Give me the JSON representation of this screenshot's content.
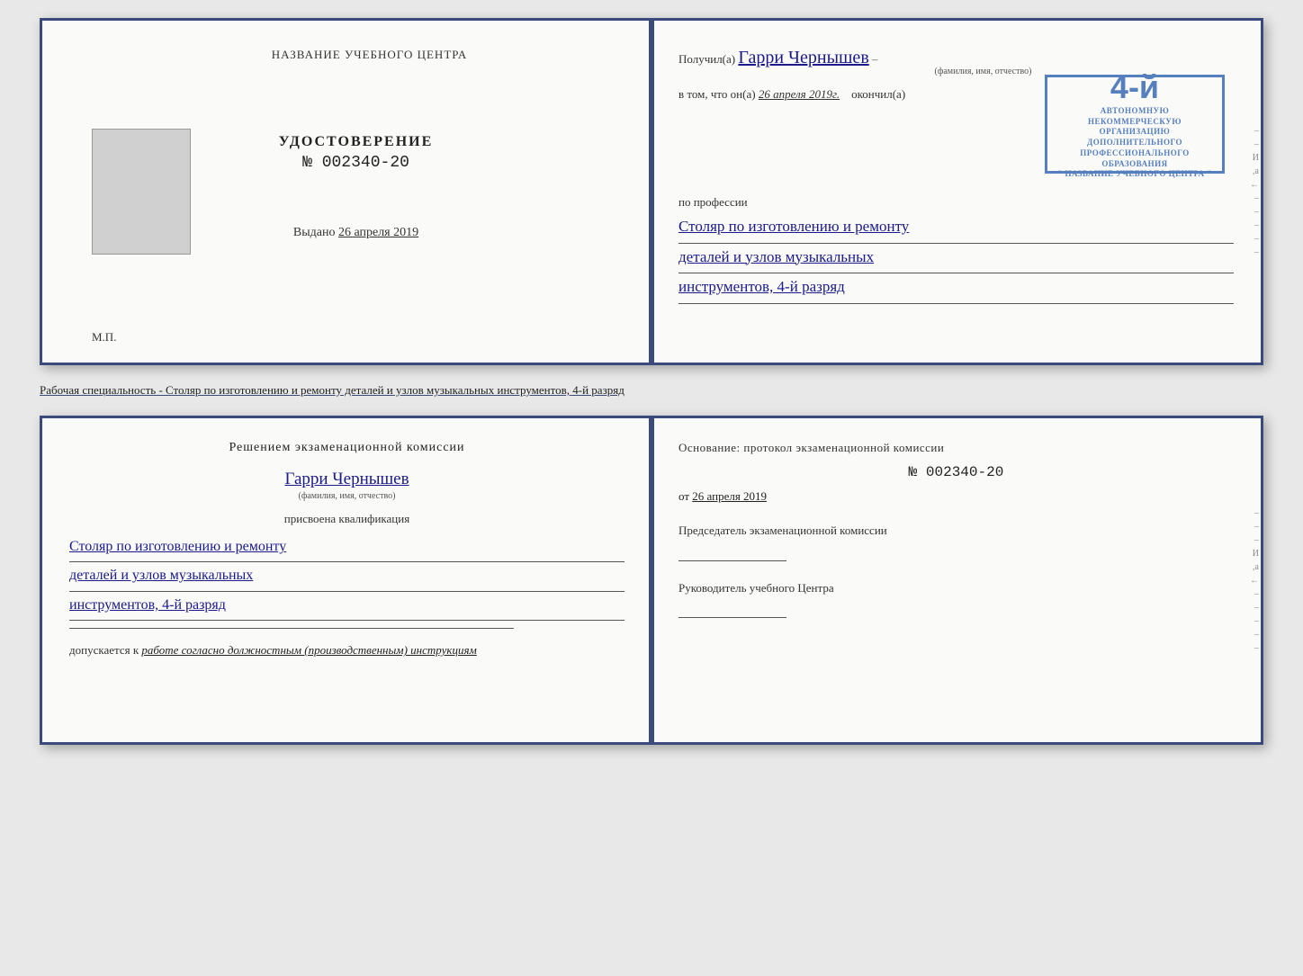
{
  "top_spread": {
    "left_page": {
      "title": "НАЗВАНИЕ УЧЕБНОГО ЦЕНТРА",
      "udostoverenie_label": "УДОСТОВЕРЕНИЕ",
      "number_prefix": "№",
      "number": "002340-20",
      "vydano_label": "Выдано",
      "vydano_date": "26 апреля 2019",
      "mp_label": "М.П."
    },
    "right_page": {
      "poluchil_label": "Получил(а)",
      "poluchil_name": "Гарри Чернышев",
      "poluchil_subtitle": "(фамилия, имя, отчество)",
      "vtom_label": "в том, что он(а)",
      "vtom_date": "26 апреля 2019г.",
      "okonchil_label": "окончил(а)",
      "stamp_number": "4-й",
      "stamp_line1": "АВТОНОМНУЮ НЕКОММЕРЧЕСКУЮ ОРГАНИЗАЦИЮ",
      "stamp_line2": "ДОПОЛНИТЕЛЬНОГО ПРОФЕССИОНАЛЬНОГО ОБРАЗОВАНИЯ",
      "stamp_line3": "\" НАЗВАНИЕ УЧЕБНОГО ЦЕНТРА \"",
      "po_professii_label": "по профессии",
      "profession_line1": "Столяр по изготовлению и ремонту",
      "profession_line2": "деталей и узлов музыкальных",
      "profession_line3": "инструментов, 4-й разряд"
    }
  },
  "specialist_text": "Рабочая специальность - Столяр по изготовлению и ремонту деталей и узлов музыкальных инструментов, 4-й разряд",
  "bottom_spread": {
    "left_page": {
      "resheniem_title": "Решением  экзаменационной  комиссии",
      "name": "Гарри Чернышев",
      "fio_subtitle": "(фамилия, имя, отчество)",
      "prisvoyena_label": "присвоена квалификация",
      "profession_line1": "Столяр по изготовлению и ремонту",
      "profession_line2": "деталей и узлов музыкальных",
      "profession_line3": "инструментов, 4-й разряд",
      "dopusk_label": "допускается к",
      "dopusk_value": "работе согласно должностным (производственным) инструкциям"
    },
    "right_page": {
      "osnovanie_label": "Основание:  протокол  экзаменационной  комиссии",
      "number_prefix": "№",
      "number": "002340-20",
      "ot_prefix": "от",
      "ot_date": "26 апреля 2019",
      "predsedatel_label": "Председатель экзаменационной комиссии",
      "rukovoditel_label": "Руководитель учебного Центра"
    }
  },
  "side_dashes": [
    "-",
    "-",
    "-",
    "-",
    "И",
    ",а",
    "←",
    "-",
    "-",
    "-",
    "-",
    "-"
  ]
}
